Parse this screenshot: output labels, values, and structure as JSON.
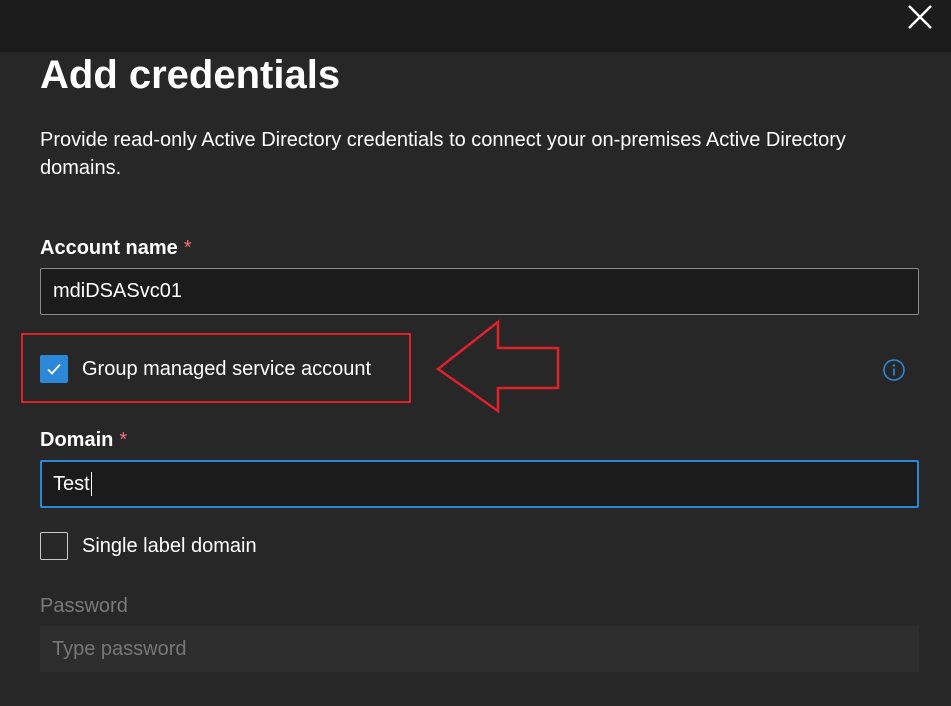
{
  "header": {
    "close_icon": "close-icon"
  },
  "dialog": {
    "title": "Add credentials",
    "description": "Provide read-only Active Directory credentials to connect your on-premises Active Directory domains."
  },
  "account_name": {
    "label": "Account name",
    "required_mark": "*",
    "value": "mdiDSASvc01"
  },
  "gmsa_checkbox": {
    "label": "Group managed service account",
    "checked": true
  },
  "domain": {
    "label": "Domain",
    "required_mark": "*",
    "value": "Test"
  },
  "single_label_checkbox": {
    "label": "Single label domain",
    "checked": false
  },
  "password": {
    "label": "Password",
    "placeholder": "Type password"
  },
  "colors": {
    "accent": "#2b88d8",
    "annotation": "#e0202a",
    "required": "#f1707b"
  }
}
